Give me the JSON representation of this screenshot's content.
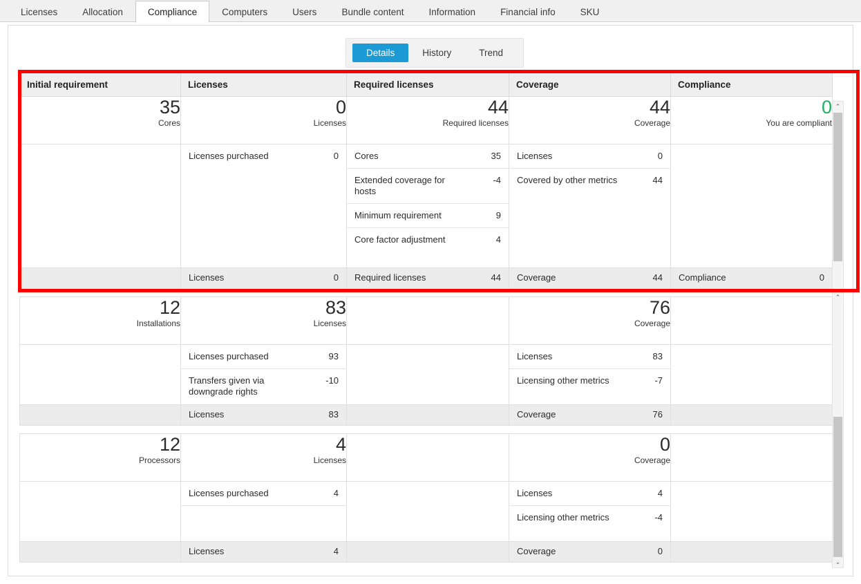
{
  "main_tabs": [
    {
      "label": "Licenses",
      "active": false
    },
    {
      "label": "Allocation",
      "active": false
    },
    {
      "label": "Compliance",
      "active": true
    },
    {
      "label": "Computers",
      "active": false
    },
    {
      "label": "Users",
      "active": false
    },
    {
      "label": "Bundle content",
      "active": false
    },
    {
      "label": "Information",
      "active": false
    },
    {
      "label": "Financial info",
      "active": false
    },
    {
      "label": "SKU",
      "active": false
    }
  ],
  "sub_tabs": [
    {
      "label": "Details",
      "active": true
    },
    {
      "label": "History",
      "active": false
    },
    {
      "label": "Trend",
      "active": false
    }
  ],
  "colors": {
    "accent": "#1b9ad6",
    "compliant_green": "#21b062",
    "highlight_red": "#ff0000"
  },
  "headers": [
    "Initial requirement",
    "Licenses",
    "Required licenses",
    "Coverage",
    "Compliance"
  ],
  "blocks": [
    {
      "name": "cores-block",
      "highlighted": true,
      "summary": [
        {
          "num": "35",
          "label": "Cores",
          "green": false
        },
        {
          "num": "0",
          "label": "Licenses",
          "green": false
        },
        {
          "num": "44",
          "label": "Required licenses",
          "green": false
        },
        {
          "num": "44",
          "label": "Coverage",
          "green": false
        },
        {
          "num": "0",
          "label": "You are compliant",
          "green": true
        }
      ],
      "details": [
        [],
        [
          {
            "label": "Licenses purchased",
            "value": "0"
          }
        ],
        [
          {
            "label": "Cores",
            "value": "35"
          },
          {
            "label": "Extended coverage for hosts",
            "value": "-4"
          },
          {
            "label": "Minimum requirement",
            "value": "9"
          },
          {
            "label": "Core factor adjustment",
            "value": "4"
          }
        ],
        [
          {
            "label": "Licenses",
            "value": "0"
          },
          {
            "label": "Covered by other metrics",
            "value": "44"
          }
        ],
        []
      ],
      "totals": [
        {
          "label": "",
          "value": ""
        },
        {
          "label": "Licenses",
          "value": "0"
        },
        {
          "label": "Required licenses",
          "value": "44"
        },
        {
          "label": "Coverage",
          "value": "44"
        },
        {
          "label": "Compliance",
          "value": "0"
        }
      ]
    },
    {
      "name": "installations-block",
      "highlighted": false,
      "summary": [
        {
          "num": "12",
          "label": "Installations",
          "green": false
        },
        {
          "num": "83",
          "label": "Licenses",
          "green": false
        },
        {
          "num": "",
          "label": "",
          "green": false
        },
        {
          "num": "76",
          "label": "Coverage",
          "green": false
        },
        {
          "num": "",
          "label": "",
          "green": false
        }
      ],
      "details": [
        [],
        [
          {
            "label": "Licenses purchased",
            "value": "93"
          },
          {
            "label": "Transfers given via downgrade rights",
            "value": "-10"
          }
        ],
        [],
        [
          {
            "label": "Licenses",
            "value": "83"
          },
          {
            "label": "Licensing other metrics",
            "value": "-7"
          }
        ],
        []
      ],
      "totals": [
        {
          "label": "",
          "value": ""
        },
        {
          "label": "Licenses",
          "value": "83"
        },
        {
          "label": "",
          "value": ""
        },
        {
          "label": "Coverage",
          "value": "76"
        },
        {
          "label": "",
          "value": ""
        }
      ]
    },
    {
      "name": "processors-block",
      "highlighted": false,
      "summary": [
        {
          "num": "12",
          "label": "Processors",
          "green": false
        },
        {
          "num": "4",
          "label": "Licenses",
          "green": false
        },
        {
          "num": "",
          "label": "",
          "green": false
        },
        {
          "num": "0",
          "label": "Coverage",
          "green": false
        },
        {
          "num": "",
          "label": "",
          "green": false
        }
      ],
      "details": [
        [],
        [
          {
            "label": "Licenses purchased",
            "value": "4"
          },
          {
            "label": "",
            "value": ""
          }
        ],
        [],
        [
          {
            "label": "Licenses",
            "value": "4"
          },
          {
            "label": "Licensing other metrics",
            "value": "-4"
          }
        ],
        []
      ],
      "totals": [
        {
          "label": "",
          "value": ""
        },
        {
          "label": "Licenses",
          "value": "4"
        },
        {
          "label": "",
          "value": ""
        },
        {
          "label": "Coverage",
          "value": "0"
        },
        {
          "label": "",
          "value": ""
        }
      ]
    }
  ],
  "scrollbars": {
    "up_arrow": "⌃",
    "down_arrow": "⌄"
  }
}
